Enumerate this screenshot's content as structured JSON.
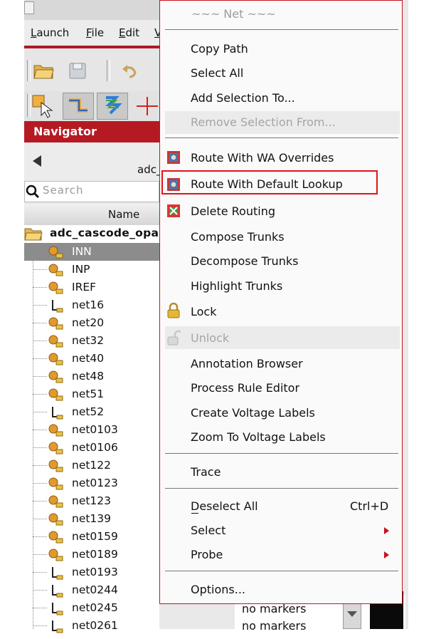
{
  "menubar": {
    "items": [
      "Launch",
      "File",
      "Edit",
      "V"
    ]
  },
  "navigator": {
    "title": "Navigator",
    "path_fragment": "adc_",
    "search_placeholder": "Search",
    "column_name": "Name",
    "root": "adc_cascode_opam",
    "nets": [
      {
        "label": "INN",
        "kind": "pin",
        "selected": true
      },
      {
        "label": "INP",
        "kind": "pin"
      },
      {
        "label": "IREF",
        "kind": "pin"
      },
      {
        "label": "net16",
        "kind": "wire"
      },
      {
        "label": "net20",
        "kind": "pin"
      },
      {
        "label": "net32",
        "kind": "pin"
      },
      {
        "label": "net40",
        "kind": "pin"
      },
      {
        "label": "net48",
        "kind": "pin"
      },
      {
        "label": "net51",
        "kind": "pin"
      },
      {
        "label": "net52",
        "kind": "wire"
      },
      {
        "label": "net0103",
        "kind": "pin"
      },
      {
        "label": "net0106",
        "kind": "pin"
      },
      {
        "label": "net122",
        "kind": "pin"
      },
      {
        "label": "net0123",
        "kind": "pin"
      },
      {
        "label": "net123",
        "kind": "pin"
      },
      {
        "label": "net139",
        "kind": "pin"
      },
      {
        "label": "net0159",
        "kind": "pin"
      },
      {
        "label": "net0189",
        "kind": "pin"
      },
      {
        "label": "net0193",
        "kind": "wire"
      },
      {
        "label": "net0244",
        "kind": "wire"
      },
      {
        "label": "net0245",
        "kind": "wire"
      },
      {
        "label": "net0261",
        "kind": "wire"
      }
    ],
    "markers": [
      "no markers",
      "no markers"
    ]
  },
  "context_menu": {
    "header": "~~~ Net ~~~",
    "items": {
      "copy_path": "Copy Path",
      "select_all": "Select All",
      "add_selection_to": "Add Selection To...",
      "remove_selection_from": "Remove Selection From...",
      "route_wa_overrides": "Route With WA Overrides",
      "route_default_lookup": "Route With Default Lookup",
      "delete_routing": "Delete Routing",
      "compose_trunks": "Compose Trunks",
      "decompose_trunks": "Decompose Trunks",
      "highlight_trunks": "Highlight Trunks",
      "lock": "Lock",
      "unlock": "Unlock",
      "annotation_browser": "Annotation Browser",
      "process_rule_editor": "Process Rule Editor",
      "create_voltage_labels": "Create Voltage Labels",
      "zoom_voltage_labels": "Zoom To Voltage Labels",
      "trace": "Trace",
      "deselect_all": "Deselect All",
      "deselect_all_shortcut": "Ctrl+D",
      "select": "Select",
      "probe": "Probe",
      "options": "Options..."
    }
  },
  "colors": {
    "accent_red": "#b51a23",
    "highlight_box": "#e0141a"
  }
}
